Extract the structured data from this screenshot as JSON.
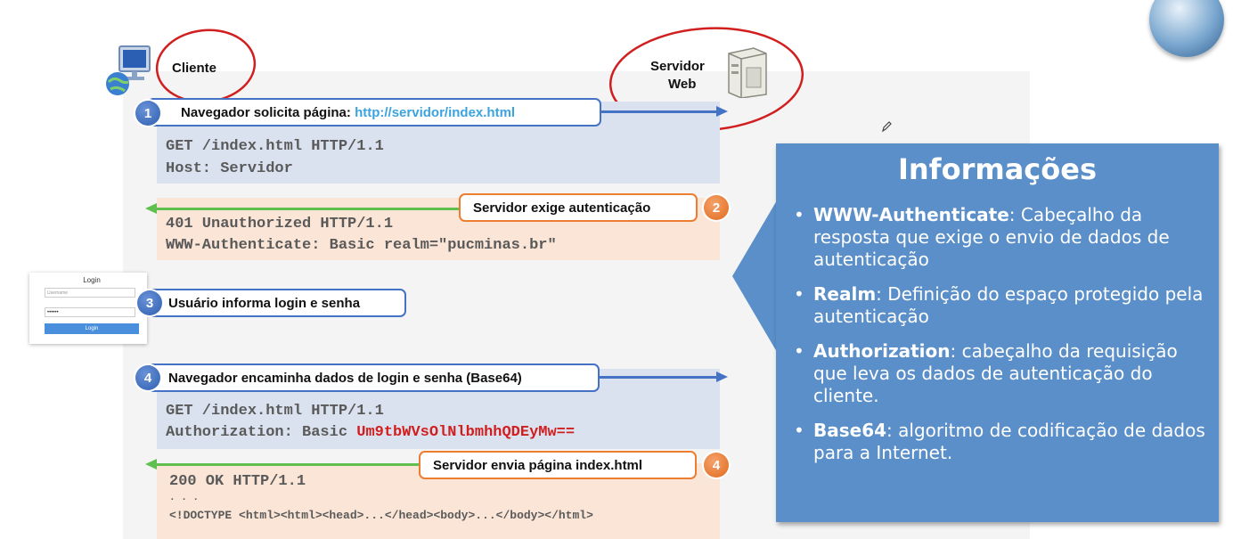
{
  "client": {
    "label": "Cliente"
  },
  "server": {
    "label_line1": "Servidor",
    "label_line2": "Web"
  },
  "steps": [
    {
      "number": "1",
      "text_prefix": "Navegador solicita página: ",
      "url": "http://servidor/index.html"
    },
    {
      "number": "2",
      "text": "Servidor exige autenticação"
    },
    {
      "number": "3",
      "text": "Usuário informa login e senha"
    },
    {
      "number": "4",
      "text": "Navegador encaminha dados de login e senha (Base64)"
    },
    {
      "number": "4",
      "text": "Servidor envia página index.html"
    }
  ],
  "request1": {
    "method": "GET",
    "line1_rest": " /index.html HTTP/1.1",
    "line2": "Host: Servidor"
  },
  "response1": {
    "line1": "401 Unauthorized HTTP/1.1",
    "line2": "WWW-Authenticate: Basic realm=\"pucminas.br\""
  },
  "login_form": {
    "title": "Login",
    "username_placeholder": "Username",
    "password_value": "••••••",
    "button_label": "Login"
  },
  "request2": {
    "line1": "GET /index.html HTTP/1.1",
    "line2_prefix": "Authorization: Basic ",
    "token": "Um9tbWVsOlNlbmhhQDEyMw=="
  },
  "response2": {
    "line1": "200 OK HTTP/1.1",
    "ellipsis": ". . .",
    "line3": "<!DOCTYPE <html><html><head>...</head><body>...</body></html>"
  },
  "info": {
    "title": "Informações",
    "items": [
      {
        "term": "WWW-Authenticate",
        "desc": ": Cabeçalho da resposta que exige o envio de dados de autenticação"
      },
      {
        "term": "Realm",
        "desc": ": Definição do espaço protegido pela autenticação"
      },
      {
        "term": "Authorization",
        "desc": ": cabeçalho da requisição que leva os dados de autenticação do cliente."
      },
      {
        "term": "Base64",
        "desc": ": algoritmo de codificação de dados para a Internet."
      }
    ]
  },
  "colors": {
    "request_bg": "#dbe2ef",
    "response_bg": "#fae5d6",
    "info_bg": "#5b8fc9",
    "blue": "#4472c4",
    "orange": "#ed7d31",
    "green": "#5fbf4f",
    "annotation_red": "#d11f1f",
    "token_red": "#d11f1f",
    "url_blue": "#3ba3e0"
  },
  "icons": [
    "computer-icon",
    "server-icon",
    "globe-icon",
    "pencil-icon"
  ]
}
